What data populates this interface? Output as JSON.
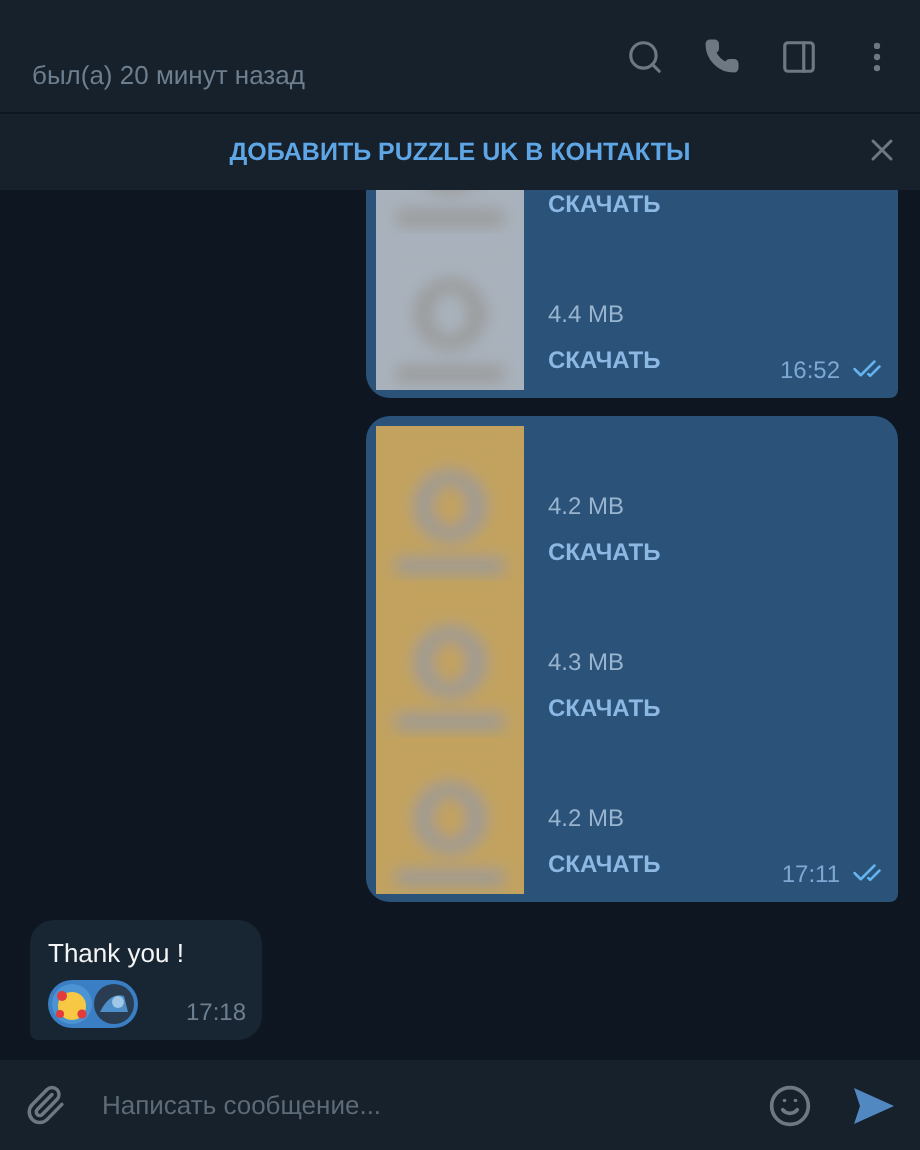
{
  "header": {
    "status": "был(а) 20 минут назад"
  },
  "banner": {
    "text": "ДОБАВИТЬ PUZZLE UK В КОНТАКТЫ"
  },
  "messages": [
    {
      "kind": "files",
      "outgoing": true,
      "time": "16:52",
      "read": true,
      "files": [
        {
          "action": "СКАЧАТЬ",
          "color": "#a9b2bc"
        },
        {
          "size": "4.4 MB",
          "action": "СКАЧАТЬ",
          "color": "#a9b2bc"
        }
      ]
    },
    {
      "kind": "files",
      "outgoing": true,
      "time": "17:11",
      "read": true,
      "files": [
        {
          "size": "4.2 MB",
          "action": "СКАЧАТЬ",
          "color": "#c2a25e"
        },
        {
          "size": "4.3 MB",
          "action": "СКАЧАТЬ",
          "color": "#c2a25e"
        },
        {
          "size": "4.2 MB",
          "action": "СКАЧАТЬ",
          "color": "#c2a25e"
        }
      ]
    },
    {
      "kind": "text",
      "outgoing": false,
      "text": "Thank you !",
      "time": "17:18"
    }
  ],
  "composer": {
    "placeholder": "Написать сообщение..."
  }
}
